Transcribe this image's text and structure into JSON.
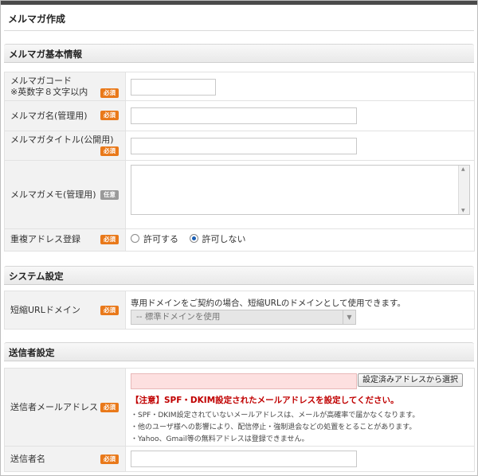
{
  "page": {
    "title": "メルマガ作成"
  },
  "basic": {
    "heading": "メルマガ基本情報",
    "code": {
      "label1": "メルマガコード",
      "label2": "※英数字８文字以内",
      "badge": "必須",
      "value": ""
    },
    "name": {
      "label": "メルマガ名(管理用)",
      "badge": "必須",
      "value": ""
    },
    "pub_title": {
      "label": "メルマガタイトル(公開用)",
      "badge": "必須",
      "value": ""
    },
    "memo": {
      "label": "メルマガメモ(管理用)",
      "badge": "任意",
      "value": ""
    },
    "dup": {
      "label": "重複アドレス登録",
      "badge": "必須",
      "opt_allow": "許可する",
      "opt_deny": "許可しない",
      "selected": "許可しない"
    }
  },
  "system": {
    "heading": "システム設定",
    "short": {
      "label": "短縮URLドメイン",
      "badge": "必須",
      "description": "専用ドメインをご契約の場合、短縮URLのドメインとして使用できます。",
      "selected": "-- 標準ドメインを使用"
    }
  },
  "sender": {
    "heading": "送信者設定",
    "email": {
      "label": "送信者メールアドレス",
      "badge": "必須",
      "value": "",
      "button": "設定済みアドレスから選択",
      "warning": "【注意】SPF・DKIM設定されたメールアドレスを設定してください。",
      "notes": [
        "・SPF・DKIM設定されていないメールアドレスは、メールが高確率で届かなくなります。",
        "・他のユーザ様への影響により、配信停止・強制退会などの処置をとることがあります。",
        "・Yahoo、Gmail等の無料アドレスは登録できません。"
      ]
    },
    "name": {
      "label": "送信者名",
      "badge": "必須",
      "value": ""
    }
  },
  "colors": {
    "required_badge": "#e9791a",
    "optional_badge": "#9a9a9a",
    "warning": "#c00000",
    "error_input": "#fde0e0"
  }
}
